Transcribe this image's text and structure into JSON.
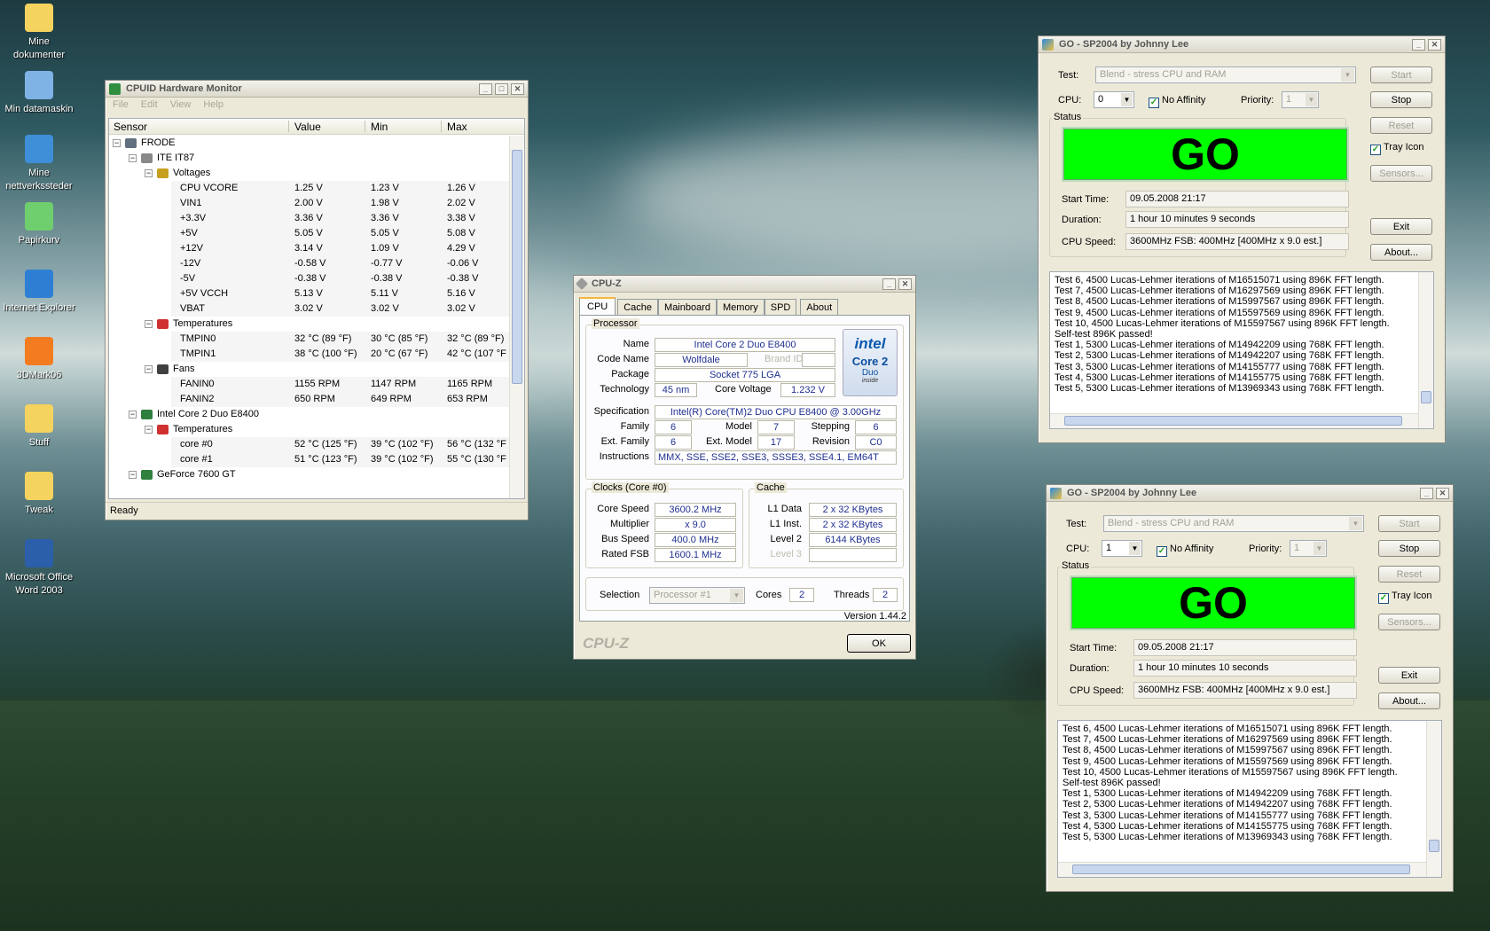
{
  "desktop": {
    "icons": [
      {
        "label": "Mine dokumenter",
        "icon": "folder-icon",
        "color": "#f4d35e"
      },
      {
        "label": "Min datamaskin",
        "icon": "computer-icon",
        "color": "#7fb3e6"
      },
      {
        "label": "Mine nettverkssteder",
        "icon": "network-icon",
        "color": "#3f8fd8"
      },
      {
        "label": "Papirkurv",
        "icon": "recycle-bin-icon",
        "color": "#6fcf6f"
      },
      {
        "label": "Internet Explorer",
        "icon": "ie-icon",
        "color": "#2e7fd3"
      },
      {
        "label": "3DMark06",
        "icon": "3dmark-icon",
        "color": "#f47c20"
      },
      {
        "label": "Stuff",
        "icon": "folder-icon",
        "color": "#f4d35e"
      },
      {
        "label": "Tweak",
        "icon": "folder-icon",
        "color": "#f4d35e"
      },
      {
        "label": "Microsoft Office Word 2003",
        "icon": "word-icon",
        "color": "#2b5faa"
      }
    ]
  },
  "hwmon": {
    "title": "CPUID Hardware Monitor",
    "menu": [
      "File",
      "Edit",
      "View",
      "Help"
    ],
    "columns": [
      "Sensor",
      "Value",
      "Min",
      "Max"
    ],
    "status": "Ready",
    "rows": [
      {
        "indent": 0,
        "expander": "−",
        "icon": "computer",
        "name": "FRODE",
        "value": "",
        "min": "",
        "max": ""
      },
      {
        "indent": 1,
        "expander": "−",
        "icon": "chip",
        "name": "ITE IT87",
        "value": "",
        "min": "",
        "max": ""
      },
      {
        "indent": 2,
        "expander": "−",
        "icon": "voltage",
        "name": "Voltages",
        "value": "",
        "min": "",
        "max": ""
      },
      {
        "indent": 3,
        "expander": "",
        "icon": "",
        "name": "CPU VCORE",
        "value": "1.25 V",
        "min": "1.23 V",
        "max": "1.26 V"
      },
      {
        "indent": 3,
        "expander": "",
        "icon": "",
        "name": "VIN1",
        "value": "2.00 V",
        "min": "1.98 V",
        "max": "2.02 V"
      },
      {
        "indent": 3,
        "expander": "",
        "icon": "",
        "name": "+3.3V",
        "value": "3.36 V",
        "min": "3.36 V",
        "max": "3.38 V"
      },
      {
        "indent": 3,
        "expander": "",
        "icon": "",
        "name": "+5V",
        "value": "5.05 V",
        "min": "5.05 V",
        "max": "5.08 V"
      },
      {
        "indent": 3,
        "expander": "",
        "icon": "",
        "name": "+12V",
        "value": "3.14 V",
        "min": "1.09 V",
        "max": "4.29 V"
      },
      {
        "indent": 3,
        "expander": "",
        "icon": "",
        "name": "-12V",
        "value": "-0.58 V",
        "min": "-0.77 V",
        "max": "-0.06 V"
      },
      {
        "indent": 3,
        "expander": "",
        "icon": "",
        "name": "-5V",
        "value": "-0.38 V",
        "min": "-0.38 V",
        "max": "-0.38 V"
      },
      {
        "indent": 3,
        "expander": "",
        "icon": "",
        "name": "+5V VCCH",
        "value": "5.13 V",
        "min": "5.11 V",
        "max": "5.16 V"
      },
      {
        "indent": 3,
        "expander": "",
        "icon": "",
        "name": "VBAT",
        "value": "3.02 V",
        "min": "3.02 V",
        "max": "3.02 V"
      },
      {
        "indent": 2,
        "expander": "−",
        "icon": "thermo",
        "name": "Temperatures",
        "value": "",
        "min": "",
        "max": ""
      },
      {
        "indent": 3,
        "expander": "",
        "icon": "",
        "name": "TMPIN0",
        "value": "32 °C  (89 °F)",
        "min": "30 °C  (85 °F)",
        "max": "32 °C  (89 °F)"
      },
      {
        "indent": 3,
        "expander": "",
        "icon": "",
        "name": "TMPIN1",
        "value": "38 °C  (100 °F)",
        "min": "20 °C  (67 °F)",
        "max": "42 °C  (107 °F"
      },
      {
        "indent": 2,
        "expander": "−",
        "icon": "fan",
        "name": "Fans",
        "value": "",
        "min": "",
        "max": ""
      },
      {
        "indent": 3,
        "expander": "",
        "icon": "",
        "name": "FANIN0",
        "value": "1155 RPM",
        "min": "1147 RPM",
        "max": "1165 RPM"
      },
      {
        "indent": 3,
        "expander": "",
        "icon": "",
        "name": "FANIN2",
        "value": "650 RPM",
        "min": "649 RPM",
        "max": "653 RPM"
      },
      {
        "indent": 1,
        "expander": "−",
        "icon": "cpu",
        "name": "Intel Core 2 Duo E8400",
        "value": "",
        "min": "",
        "max": ""
      },
      {
        "indent": 2,
        "expander": "−",
        "icon": "thermo",
        "name": "Temperatures",
        "value": "",
        "min": "",
        "max": ""
      },
      {
        "indent": 3,
        "expander": "",
        "icon": "",
        "name": "core #0",
        "value": "52 °C  (125 °F)",
        "min": "39 °C  (102 °F)",
        "max": "56 °C  (132 °F"
      },
      {
        "indent": 3,
        "expander": "",
        "icon": "",
        "name": "core #1",
        "value": "51 °C  (123 °F)",
        "min": "39 °C  (102 °F)",
        "max": "55 °C  (130 °F"
      },
      {
        "indent": 1,
        "expander": "−",
        "icon": "gpu",
        "name": "GeForce 7600 GT",
        "value": "",
        "min": "",
        "max": ""
      }
    ]
  },
  "cpuz": {
    "title": "CPU-Z",
    "tabs": [
      "CPU",
      "Cache",
      "Mainboard",
      "Memory",
      "SPD",
      "About"
    ],
    "processor_label": "Processor",
    "name_label": "Name",
    "name": "Intel Core 2 Duo E8400",
    "codename_label": "Code Name",
    "codename": "Wolfdale",
    "brandid_label": "Brand ID",
    "package_label": "Package",
    "package": "Socket 775 LGA",
    "technology_label": "Technology",
    "technology": "45 nm",
    "corevoltage_label": "Core Voltage",
    "corevoltage": "1.232 V",
    "spec_label": "Specification",
    "spec": "Intel(R) Core(TM)2 Duo CPU     E8400  @ 3.00GHz",
    "family_label": "Family",
    "family": "6",
    "model_label": "Model",
    "model": "7",
    "stepping_label": "Stepping",
    "stepping": "6",
    "extfamily_label": "Ext. Family",
    "extfamily": "6",
    "extmodel_label": "Ext. Model",
    "extmodel": "17",
    "revision_label": "Revision",
    "revision": "C0",
    "instructions_label": "Instructions",
    "instructions": "MMX, SSE, SSE2, SSE3, SSSE3, SSE4.1, EM64T",
    "clocks_label": "Clocks (Core #0)",
    "corespeed_label": "Core Speed",
    "corespeed": "3600.2 MHz",
    "multiplier_label": "Multiplier",
    "multiplier": "x 9.0",
    "busspeed_label": "Bus Speed",
    "busspeed": "400.0 MHz",
    "ratedfsb_label": "Rated FSB",
    "ratedfsb": "1600.1 MHz",
    "cache_label": "Cache",
    "l1data_label": "L1 Data",
    "l1data": "2 x 32 KBytes",
    "l1inst_label": "L1 Inst.",
    "l1inst": "2 x 32 KBytes",
    "level2_label": "Level 2",
    "level2": "6144 KBytes",
    "level3_label": "Level 3",
    "selection_label": "Selection",
    "selection": "Processor #1",
    "cores_label": "Cores",
    "cores": "2",
    "threads_label": "Threads",
    "threads": "2",
    "version": "Version 1.44.2",
    "logo_text": "CPU-Z",
    "ok_label": "OK",
    "intel_logo": {
      "brand": "intel",
      "line1": "Core 2",
      "line2": "Duo",
      "line3": "inside"
    }
  },
  "sp1": {
    "title": "GO - SP2004 by Johnny Lee",
    "test_label": "Test:",
    "test_value": "Blend - stress CPU and RAM",
    "cpu_label": "CPU:",
    "cpu_value": "0",
    "noaffinity_label": "No Affinity",
    "priority_label": "Priority:",
    "priority_value": "1",
    "status_label": "Status",
    "go_text": "GO",
    "start_time_label": "Start Time:",
    "start_time": "09.05.2008 21:17",
    "duration_label": "Duration:",
    "duration": "1 hour 10 minutes 9 seconds",
    "cpuspeed_label": "CPU Speed:",
    "cpuspeed": "3600MHz FSB: 400MHz [400MHz x 9.0 est.]",
    "buttons": {
      "start": "Start",
      "stop": "Stop",
      "reset": "Reset",
      "tray": "Tray Icon",
      "sensors": "Sensors...",
      "exit": "Exit",
      "about": "About..."
    },
    "log": [
      "Test 6, 4500 Lucas-Lehmer iterations of M16515071 using 896K FFT length.",
      "Test 7, 4500 Lucas-Lehmer iterations of M16297569 using 896K FFT length.",
      "Test 8, 4500 Lucas-Lehmer iterations of M15997567 using 896K FFT length.",
      "Test 9, 4500 Lucas-Lehmer iterations of M15597569 using 896K FFT length.",
      "Test 10, 4500 Lucas-Lehmer iterations of M15597567 using 896K FFT length.",
      "Self-test 896K passed!",
      "Test 1, 5300 Lucas-Lehmer iterations of M14942209 using 768K FFT length.",
      "Test 2, 5300 Lucas-Lehmer iterations of M14942207 using 768K FFT length.",
      "Test 3, 5300 Lucas-Lehmer iterations of M14155777 using 768K FFT length.",
      "Test 4, 5300 Lucas-Lehmer iterations of M14155775 using 768K FFT length.",
      "Test 5, 5300 Lucas-Lehmer iterations of M13969343 using 768K FFT length."
    ]
  },
  "sp2": {
    "title": "GO - SP2004 by Johnny Lee",
    "test_label": "Test:",
    "test_value": "Blend - stress CPU and RAM",
    "cpu_label": "CPU:",
    "cpu_value": "1",
    "noaffinity_label": "No Affinity",
    "priority_label": "Priority:",
    "priority_value": "1",
    "status_label": "Status",
    "go_text": "GO",
    "start_time_label": "Start Time:",
    "start_time": "09.05.2008 21:17",
    "duration_label": "Duration:",
    "duration": "1 hour 10 minutes 10 seconds",
    "cpuspeed_label": "CPU Speed:",
    "cpuspeed": "3600MHz FSB: 400MHz [400MHz x 9.0 est.]",
    "buttons": {
      "start": "Start",
      "stop": "Stop",
      "reset": "Reset",
      "tray": "Tray Icon",
      "sensors": "Sensors...",
      "exit": "Exit",
      "about": "About..."
    },
    "log": [
      "Test 6, 4500 Lucas-Lehmer iterations of M16515071 using 896K FFT length.",
      "Test 7, 4500 Lucas-Lehmer iterations of M16297569 using 896K FFT length.",
      "Test 8, 4500 Lucas-Lehmer iterations of M15997567 using 896K FFT length.",
      "Test 9, 4500 Lucas-Lehmer iterations of M15597569 using 896K FFT length.",
      "Test 10, 4500 Lucas-Lehmer iterations of M15597567 using 896K FFT length.",
      "Self-test 896K passed!",
      "Test 1, 5300 Lucas-Lehmer iterations of M14942209 using 768K FFT length.",
      "Test 2, 5300 Lucas-Lehmer iterations of M14942207 using 768K FFT length.",
      "Test 3, 5300 Lucas-Lehmer iterations of M14155777 using 768K FFT length.",
      "Test 4, 5300 Lucas-Lehmer iterations of M14155775 using 768K FFT length.",
      "Test 5, 5300 Lucas-Lehmer iterations of M13969343 using 768K FFT length."
    ]
  }
}
